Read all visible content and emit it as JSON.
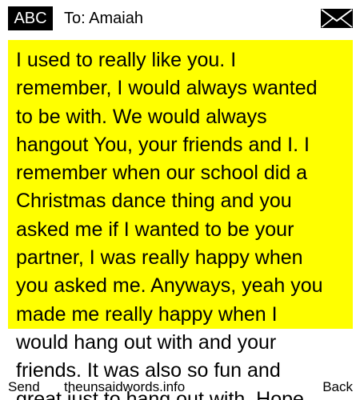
{
  "header": {
    "mode_label": "ABC",
    "recipient": "To: Amaiah",
    "message_icon": "envelope-icon"
  },
  "message": {
    "text": "I used to really like you. I\nremember, I would always wanted\nto be with. We would always\nhangout You, your friends and I. I\nremember when our school did a\nChristmas dance thing and you\nasked me if I wanted to be your\npartner, I was really happy when\nyou asked me. Anyways, yeah you\nmade me really happy when I\nwould hang out with and your\nfriends. It was also so fun and\ngreat just to hang out with. Hope"
  },
  "footer": {
    "left_softkey": "Send",
    "center_text": "theunsaidwords.info",
    "right_softkey": "Back"
  },
  "colors": {
    "highlight": "#ffff00",
    "badge_background": "#000000",
    "badge_text": "#ffffff"
  }
}
